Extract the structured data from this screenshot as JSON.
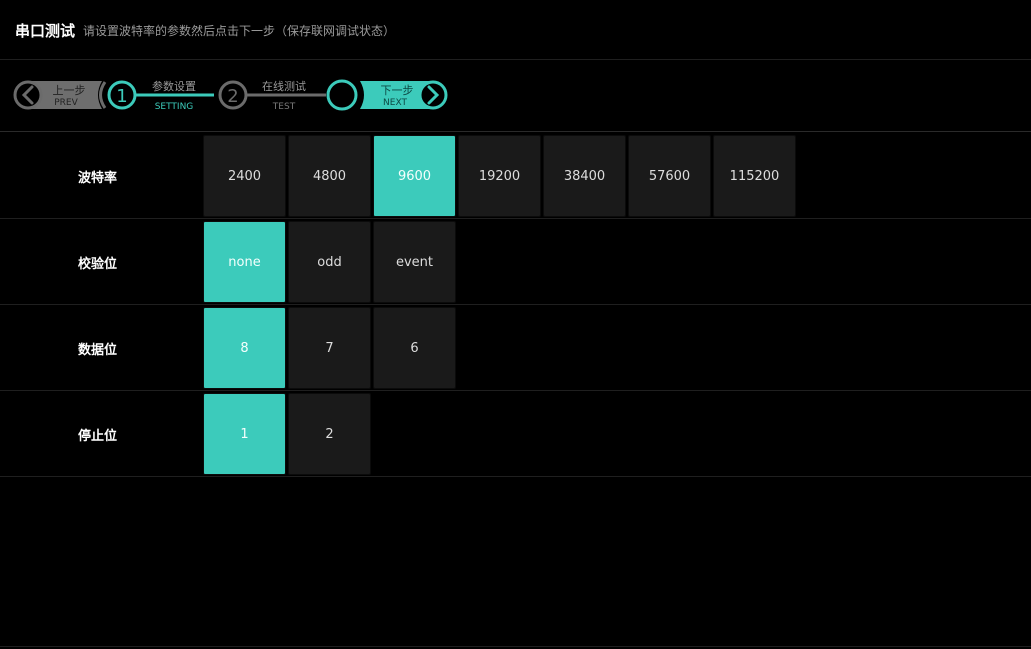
{
  "header": {
    "title": "串口测试",
    "subtitle": "请设置波特率的参数然后点击下一步（保存联网调试状态）"
  },
  "wizard": {
    "prev": {
      "label": "上一步",
      "sub": "PREV"
    },
    "step1": {
      "number": "1",
      "label": "参数设置",
      "sub": "SETTING"
    },
    "step2": {
      "number": "2",
      "label": "在线测试",
      "sub": "TEST"
    },
    "next": {
      "label": "下一步",
      "sub": "NEXT"
    },
    "colors": {
      "accent": "#3ccbbb",
      "inactive": "#6b6b6b"
    }
  },
  "rows": [
    {
      "label": "波特率",
      "options": [
        "2400",
        "4800",
        "9600",
        "19200",
        "38400",
        "57600",
        "115200"
      ],
      "selected": 2
    },
    {
      "label": "校验位",
      "options": [
        "none",
        "odd",
        "event"
      ],
      "selected": 0
    },
    {
      "label": "数据位",
      "options": [
        "8",
        "7",
        "6"
      ],
      "selected": 0
    },
    {
      "label": "停止位",
      "options": [
        "1",
        "2"
      ],
      "selected": 0
    }
  ]
}
